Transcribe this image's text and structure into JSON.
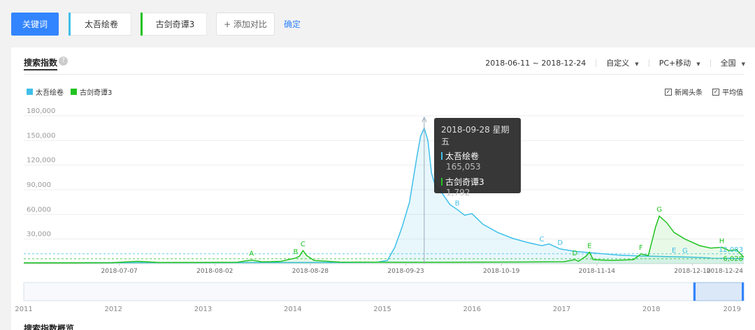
{
  "toolbar": {
    "keyword_label": "关键词",
    "terms": [
      {
        "label": "太吾绘卷",
        "color": "#3fc0e8"
      },
      {
        "label": "古剑奇谭3",
        "color": "#22c322"
      }
    ],
    "add_label": "+ 添加对比",
    "confirm_label": "确定"
  },
  "panel": {
    "title": "搜索指数",
    "help_icon": "?",
    "date_range": "2018-06-11 ~ 2018-12-24",
    "custom_label": "自定义",
    "device_label": "PC+移动",
    "region_label": "全国",
    "checkbox_news": "新闻头条",
    "checkbox_avg": "平均值",
    "check_glyph": "✓",
    "caret_glyph": "▼"
  },
  "tooltip": {
    "date": "2018-09-28 星期五",
    "rows": [
      {
        "label": "太吾绘卷",
        "value": "165,053"
      },
      {
        "label": "古剑奇谭3",
        "value": "1,792"
      }
    ]
  },
  "bottom_title": "搜索指数概览",
  "chart_data": {
    "type": "line",
    "x_ticks": [
      "2018-07-07",
      "2018-08-02",
      "2018-08-28",
      "2018-09-23",
      "2018-10-19",
      "2018-11-14",
      "2018-12-10",
      "2018-12-24"
    ],
    "y_ticks": [
      "180,000",
      "150,000",
      "120,000",
      "90,000",
      "60,000",
      "30,000"
    ],
    "ylim": [
      0,
      180000
    ],
    "x_range": [
      "2018-06-11",
      "2018-12-24"
    ],
    "grid": true,
    "legend_position": "top-left",
    "series": [
      {
        "name": "太吾绘卷",
        "color": "#3fc0e8",
        "average": 12083,
        "last_value": 12083,
        "points": [
          [
            "2018-06-11",
            1200
          ],
          [
            "2018-07-01",
            1300
          ],
          [
            "2018-08-01",
            1400
          ],
          [
            "2018-09-01",
            1500
          ],
          [
            "2018-09-15",
            1800
          ],
          [
            "2018-09-18",
            4000
          ],
          [
            "2018-09-20",
            20000
          ],
          [
            "2018-09-22",
            45000
          ],
          [
            "2018-09-24",
            75000
          ],
          [
            "2018-09-26",
            130000
          ],
          [
            "2018-09-27",
            155000
          ],
          [
            "2018-09-28",
            165053
          ],
          [
            "2018-09-29",
            150000
          ],
          [
            "2018-09-30",
            110000
          ],
          [
            "2018-10-01",
            95000
          ],
          [
            "2018-10-03",
            85000
          ],
          [
            "2018-10-05",
            72000
          ],
          [
            "2018-10-07",
            66000
          ],
          [
            "2018-10-09",
            59000
          ],
          [
            "2018-10-11",
            61000
          ],
          [
            "2018-10-14",
            48000
          ],
          [
            "2018-10-18",
            38000
          ],
          [
            "2018-10-22",
            31000
          ],
          [
            "2018-10-26",
            26000
          ],
          [
            "2018-10-30",
            22000
          ],
          [
            "2018-11-01",
            24000
          ],
          [
            "2018-11-04",
            18000
          ],
          [
            "2018-11-08",
            15000
          ],
          [
            "2018-11-12",
            13500
          ],
          [
            "2018-11-16",
            12000
          ],
          [
            "2018-11-20",
            10500
          ],
          [
            "2018-11-25",
            9500
          ],
          [
            "2018-11-30",
            9000
          ],
          [
            "2018-12-05",
            8500
          ],
          [
            "2018-12-10",
            8000
          ],
          [
            "2018-12-15",
            7000
          ],
          [
            "2018-12-20",
            6500
          ],
          [
            "2018-12-24",
            6000
          ]
        ]
      },
      {
        "name": "古剑奇谭3",
        "color": "#22c322",
        "average": 6028,
        "last_value": 6028,
        "points": [
          [
            "2018-06-11",
            1000
          ],
          [
            "2018-06-25",
            1100
          ],
          [
            "2018-07-05",
            1300
          ],
          [
            "2018-07-12",
            3000
          ],
          [
            "2018-07-18",
            1500
          ],
          [
            "2018-07-28",
            1600
          ],
          [
            "2018-08-08",
            1800
          ],
          [
            "2018-08-12",
            4500
          ],
          [
            "2018-08-15",
            2200
          ],
          [
            "2018-08-20",
            3000
          ],
          [
            "2018-08-24",
            7000
          ],
          [
            "2018-08-25",
            9000
          ],
          [
            "2018-08-26",
            16000
          ],
          [
            "2018-08-27",
            10000
          ],
          [
            "2018-08-29",
            4000
          ],
          [
            "2018-09-05",
            2000
          ],
          [
            "2018-09-20",
            1800
          ],
          [
            "2018-09-28",
            1792
          ],
          [
            "2018-10-10",
            1900
          ],
          [
            "2018-10-25",
            2100
          ],
          [
            "2018-11-05",
            2500
          ],
          [
            "2018-11-08",
            5000
          ],
          [
            "2018-11-09",
            3000
          ],
          [
            "2018-11-11",
            9000
          ],
          [
            "2018-11-12",
            14000
          ],
          [
            "2018-11-13",
            5000
          ],
          [
            "2018-11-18",
            4000
          ],
          [
            "2018-11-24",
            5000
          ],
          [
            "2018-11-26",
            12000
          ],
          [
            "2018-11-28",
            10000
          ],
          [
            "2018-11-30",
            45000
          ],
          [
            "2018-12-01",
            58000
          ],
          [
            "2018-12-03",
            50000
          ],
          [
            "2018-12-05",
            38000
          ],
          [
            "2018-12-08",
            30000
          ],
          [
            "2018-12-12",
            22000
          ],
          [
            "2018-12-15",
            19000
          ],
          [
            "2018-12-18",
            20000
          ],
          [
            "2018-12-20",
            16000
          ],
          [
            "2018-12-22",
            17000
          ],
          [
            "2018-12-24",
            8000
          ]
        ]
      }
    ],
    "annotations": [
      {
        "label": "A",
        "series": "古剑奇谭3",
        "x": "2018-08-12",
        "y": 4500
      },
      {
        "label": "B",
        "series": "古剑奇谭3",
        "x": "2018-08-24",
        "y": 7000
      },
      {
        "label": "C",
        "series": "古剑奇谭3",
        "x": "2018-08-26",
        "y": 16000
      },
      {
        "label": "B",
        "series": "太吾绘卷",
        "x": "2018-10-07",
        "y": 66000
      },
      {
        "label": "C",
        "series": "太吾绘卷",
        "x": "2018-10-30",
        "y": 22000
      },
      {
        "label": "D",
        "series": "太吾绘卷",
        "x": "2018-11-04",
        "y": 18000
      },
      {
        "label": "D",
        "series": "古剑奇谭3",
        "x": "2018-11-08",
        "y": 5000
      },
      {
        "label": "E",
        "series": "古剑奇谭3",
        "x": "2018-11-12",
        "y": 14000
      },
      {
        "label": "F",
        "series": "古剑奇谭3",
        "x": "2018-11-26",
        "y": 12000
      },
      {
        "label": "G",
        "series": "古剑奇谭3",
        "x": "2018-12-01",
        "y": 58000
      },
      {
        "label": "E",
        "series": "太吾绘卷",
        "x": "2018-12-05",
        "y": 8500
      },
      {
        "label": "G",
        "series": "太吾绘卷",
        "x": "2018-12-08",
        "y": 8200
      },
      {
        "label": "H",
        "series": "古剑奇谭3",
        "x": "2018-12-18",
        "y": 20000
      }
    ],
    "average_labels": [
      "12,083",
      "6,028"
    ],
    "tooltip_date": "2018-09-28",
    "overview": {
      "year_ticks": [
        "2011",
        "2012",
        "2013",
        "2014",
        "2015",
        "2016",
        "2017",
        "2018",
        "2019"
      ]
    }
  }
}
